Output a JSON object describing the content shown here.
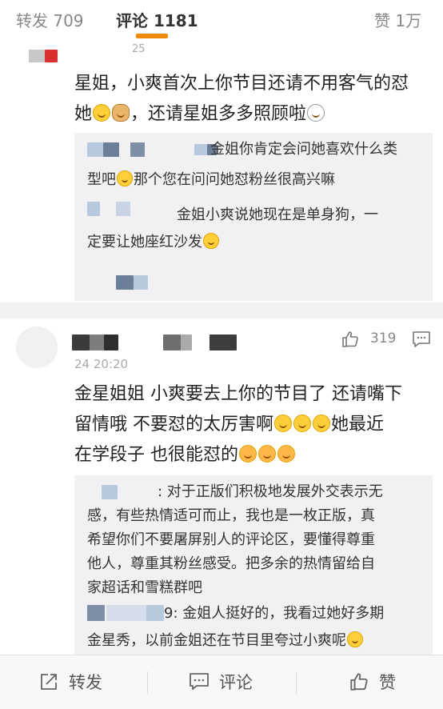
{
  "tabs": {
    "repost": "转发 709",
    "comment": "评论 1181",
    "like": "赞 1万"
  },
  "comment1": {
    "time_fragment": "25",
    "text_line1": "星姐，小爽首次上你节目还请不用客气的怼",
    "text_line2_a": "她",
    "text_line2_b": "，还请星姐多多照顾啦",
    "replies": [
      {
        "line1": "金姐你肯定会问她喜欢什么类",
        "line2": "型吧",
        "line2_b": "那个您在问问她怼粉丝很高兴嘛"
      },
      {
        "line1": "金姐小爽说她现在是单身狗，一",
        "line2": "定要让她座红沙发"
      }
    ]
  },
  "comment2": {
    "like_count": "319",
    "time": "24 20:20",
    "text_line1": "金星姐姐  小爽要去上你的节目了  还请嘴下",
    "text_line2_a": "留情哦  不要怼的太厉害啊",
    "text_line2_b": "她最近",
    "text_line3": "在学段子  也很能怼的",
    "replies": [
      {
        "line1": ": 对于正版们积极地发展外交表示无",
        "line2": "感，有些热情适可而止，我也是一枚正版，真",
        "line3": "希望你们不要屠屏别人的评论区，要懂得尊重",
        "line4": "他人，尊重其粉丝感受。把多余的热情留给自",
        "line5": "家超话和雪糕群吧"
      },
      {
        "line1": "9: 金姐人挺好的，我看过她好多期",
        "line2": "金星秀，以前金姐还在节目里夸过小爽呢"
      }
    ]
  },
  "bottom_bar": {
    "repost_label": "转发",
    "comment_label": "评论",
    "like_label": "赞"
  },
  "colors": {
    "accent": "#f08a00",
    "reply_bg": "#f1f1f3",
    "text": "#222222"
  }
}
